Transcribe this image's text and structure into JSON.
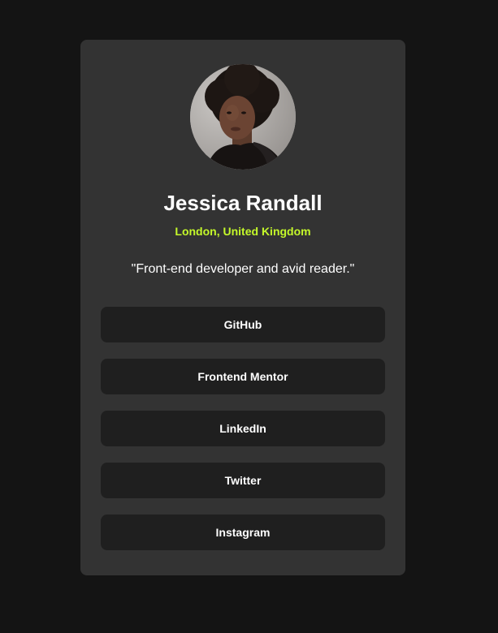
{
  "profile": {
    "avatar_icon": "profile-photo",
    "name": "Jessica Randall",
    "location": "London, United Kingdom",
    "bio": "\"Front-end developer and avid reader.\""
  },
  "links": [
    {
      "label": "GitHub"
    },
    {
      "label": "Frontend Mentor"
    },
    {
      "label": "LinkedIn"
    },
    {
      "label": "Twitter"
    },
    {
      "label": "Instagram"
    }
  ],
  "colors": {
    "page_background": "#141414",
    "card_background": "#333333",
    "button_background": "#1f1f1f",
    "accent": "#c4f82a",
    "text": "#ffffff"
  }
}
